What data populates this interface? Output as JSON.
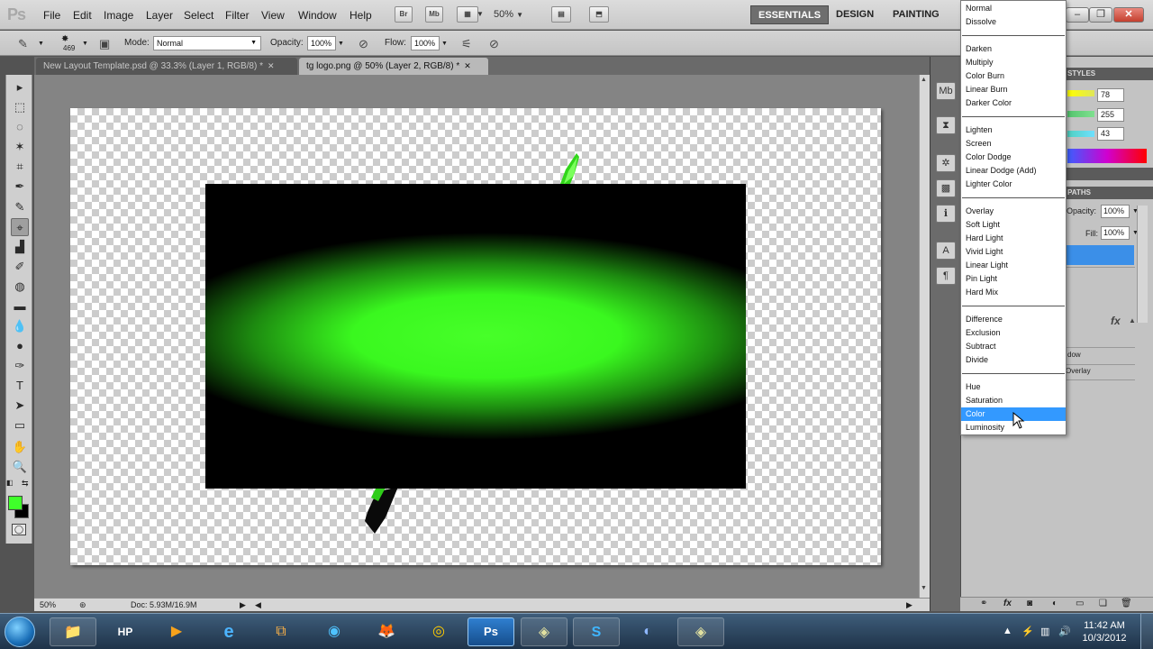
{
  "app": {
    "logo": "Ps"
  },
  "menu": [
    "File",
    "Edit",
    "Image",
    "Layer",
    "Select",
    "Filter",
    "View",
    "Window",
    "Help"
  ],
  "appbar": {
    "bridge": "Br",
    "minibridge": "Mb",
    "zoom": "50%",
    "zoom_arrow": "▼"
  },
  "workspaces": [
    "ESSENTIALS",
    "DESIGN",
    "PAINTING"
  ],
  "window_controls": {
    "minimize": "–",
    "restore": "❐",
    "close": "✕"
  },
  "options": {
    "brush_size": "469",
    "mode_label": "Mode:",
    "mode_value": "Normal",
    "opacity_label": "Opacity:",
    "opacity_value": "100%",
    "flow_label": "Flow:",
    "flow_value": "100%"
  },
  "tabs": [
    {
      "label": "New Layout Template.psd @ 33.3% (Layer 1, RGB/8) *",
      "close": "✕"
    },
    {
      "label": "tg logo.png @ 50% (Layer 2, RGB/8) *",
      "close": "✕"
    }
  ],
  "tools": [
    "▸",
    "⬚",
    "◌",
    "✶",
    "⌗",
    "✒",
    "✎",
    "⌖",
    "▟",
    "✐",
    "◍",
    "▬",
    "💧",
    "●",
    "✑",
    "T",
    "➤",
    "▭",
    "✋",
    "🔍"
  ],
  "status": {
    "zoom": "50%",
    "doc": "Doc: 5.93M/16.9M"
  },
  "panels": {
    "styles_tab": "STYLES",
    "paths_tab": "PATHS",
    "color_values": [
      "78",
      "255",
      "43"
    ],
    "opacity_label": "Opacity:",
    "opacity_value": "100%",
    "fill_label": "Fill:",
    "fill_value": "100%",
    "fx": "fx",
    "effect_rows": [
      "dow",
      "Overlay"
    ]
  },
  "blend_modes": [
    [
      "Normal",
      "Dissolve"
    ],
    [
      "Darken",
      "Multiply",
      "Color Burn",
      "Linear Burn",
      "Darker Color"
    ],
    [
      "Lighten",
      "Screen",
      "Color Dodge",
      "Linear Dodge (Add)",
      "Lighter Color"
    ],
    [
      "Overlay",
      "Soft Light",
      "Hard Light",
      "Vivid Light",
      "Linear Light",
      "Pin Light",
      "Hard Mix"
    ],
    [
      "Difference",
      "Exclusion",
      "Subtract",
      "Divide"
    ],
    [
      "Hue",
      "Saturation",
      "Color",
      "Luminosity"
    ]
  ],
  "blend_selected": "Color",
  "taskbar": {
    "apps": [
      "📁",
      "HP",
      "▶",
      "e",
      "⧉",
      "◉",
      "🦊",
      "◎",
      "Ps",
      "◈",
      "S",
      "◐",
      "◈"
    ],
    "clock_time": "11:42 AM",
    "clock_date": "10/3/2012"
  },
  "colors": {
    "foreground": "#3fff2a",
    "background": "#000000",
    "highlight": "#3399ff",
    "glow": "#47ff29"
  }
}
